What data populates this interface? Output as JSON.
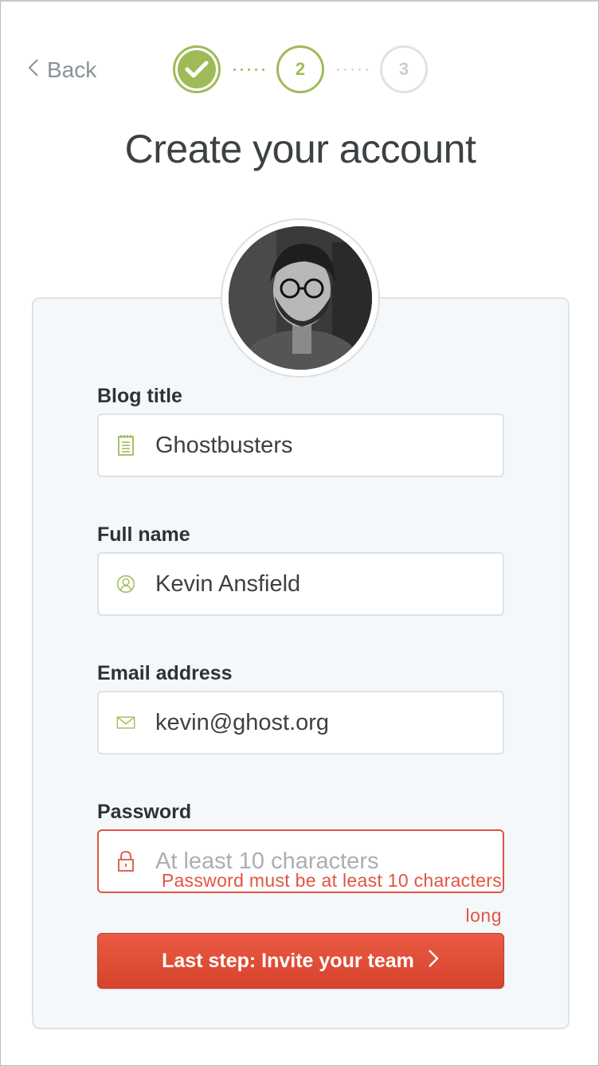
{
  "header": {
    "back_label": "Back",
    "steps": [
      {
        "state": "done",
        "label": ""
      },
      {
        "state": "active",
        "label": "2"
      },
      {
        "state": "pending",
        "label": "3"
      }
    ],
    "title": "Create your account"
  },
  "form": {
    "blog_title": {
      "label": "Blog title",
      "value": "Ghostbusters",
      "icon": "notepad-icon"
    },
    "full_name": {
      "label": "Full name",
      "value": "Kevin Ansfield",
      "icon": "user-icon"
    },
    "email": {
      "label": "Email address",
      "value": "kevin@ghost.org",
      "icon": "envelope-icon"
    },
    "password": {
      "label": "Password",
      "placeholder": "At least 10 characters",
      "value": "",
      "icon": "lock-icon",
      "error_line1": "Password must be at least 10 characters",
      "error_line2": "long"
    }
  },
  "cta": {
    "label": "Last step: Invite your team"
  },
  "colors": {
    "accent_green": "#9fbb58",
    "error_red": "#e25440",
    "button_red": "#dd4a34",
    "pending_grey": "#dfe1e3"
  }
}
